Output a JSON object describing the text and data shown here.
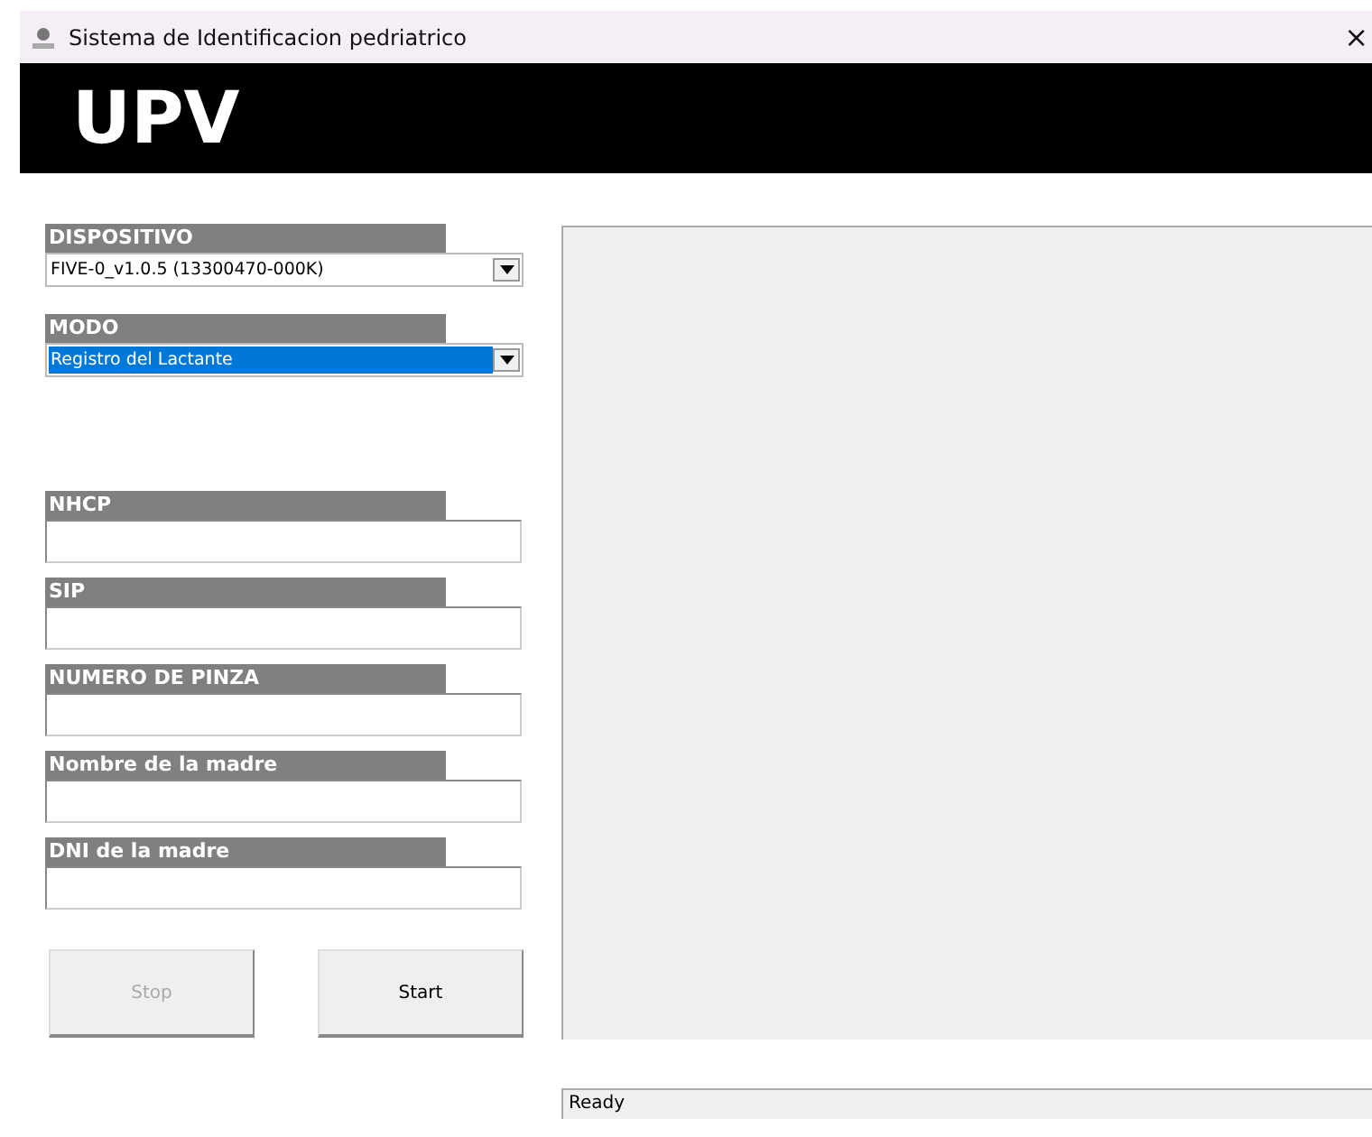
{
  "window": {
    "title": "Sistema de Identificacion pedriatrico",
    "close": "×"
  },
  "header": {
    "logo": "UPV"
  },
  "selectors": [
    {
      "label": "DISPOSITIVO",
      "value": "FIVE-0_v1.0.5 (13300470-000K)",
      "focused": false
    },
    {
      "label": "MODO",
      "value": "Registro del Lactante",
      "focused": true
    }
  ],
  "fields": [
    {
      "label": "NHCP"
    },
    {
      "label": "SIP"
    },
    {
      "label": "NUMERO DE PINZA"
    },
    {
      "label": "Nombre de la madre"
    },
    {
      "label": "DNI de la madre"
    }
  ],
  "buttons": [
    {
      "label": "Stop",
      "disabled": true
    },
    {
      "label": "Start",
      "disabled": false
    }
  ],
  "status_bar": "Ready"
}
